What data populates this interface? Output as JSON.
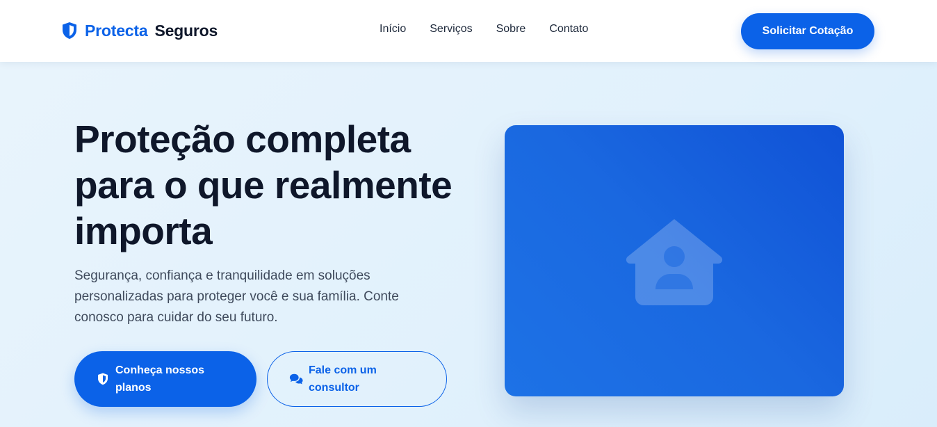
{
  "header": {
    "brand": "Protecta",
    "brand_suffix": "Seguros",
    "logo_icon": "shield-icon",
    "nav": [
      {
        "label": "Início"
      },
      {
        "label": "Serviços"
      },
      {
        "label": "Sobre"
      },
      {
        "label": "Contato"
      }
    ],
    "cta_label": "Solicitar Cotação"
  },
  "hero": {
    "title": "Proteção completa para o que realmente importa",
    "description": "Segurança, confiança e tranquilidade em soluções personalizadas para proteger você e sua família. Conte conosco para cuidar do seu futuro.",
    "primary_button": {
      "label": "Conheça nossos planos",
      "icon": "shield-icon"
    },
    "secondary_button": {
      "label": "Fale com um consultor",
      "icon": "chat-bubbles-icon"
    },
    "image_icon": "house-user-icon"
  },
  "colors": {
    "primary": "#0b62e8",
    "text_dark": "#0f172a",
    "text_muted": "#3f4a5c",
    "background": "#e3f2fc",
    "card": "#1a68e0"
  }
}
